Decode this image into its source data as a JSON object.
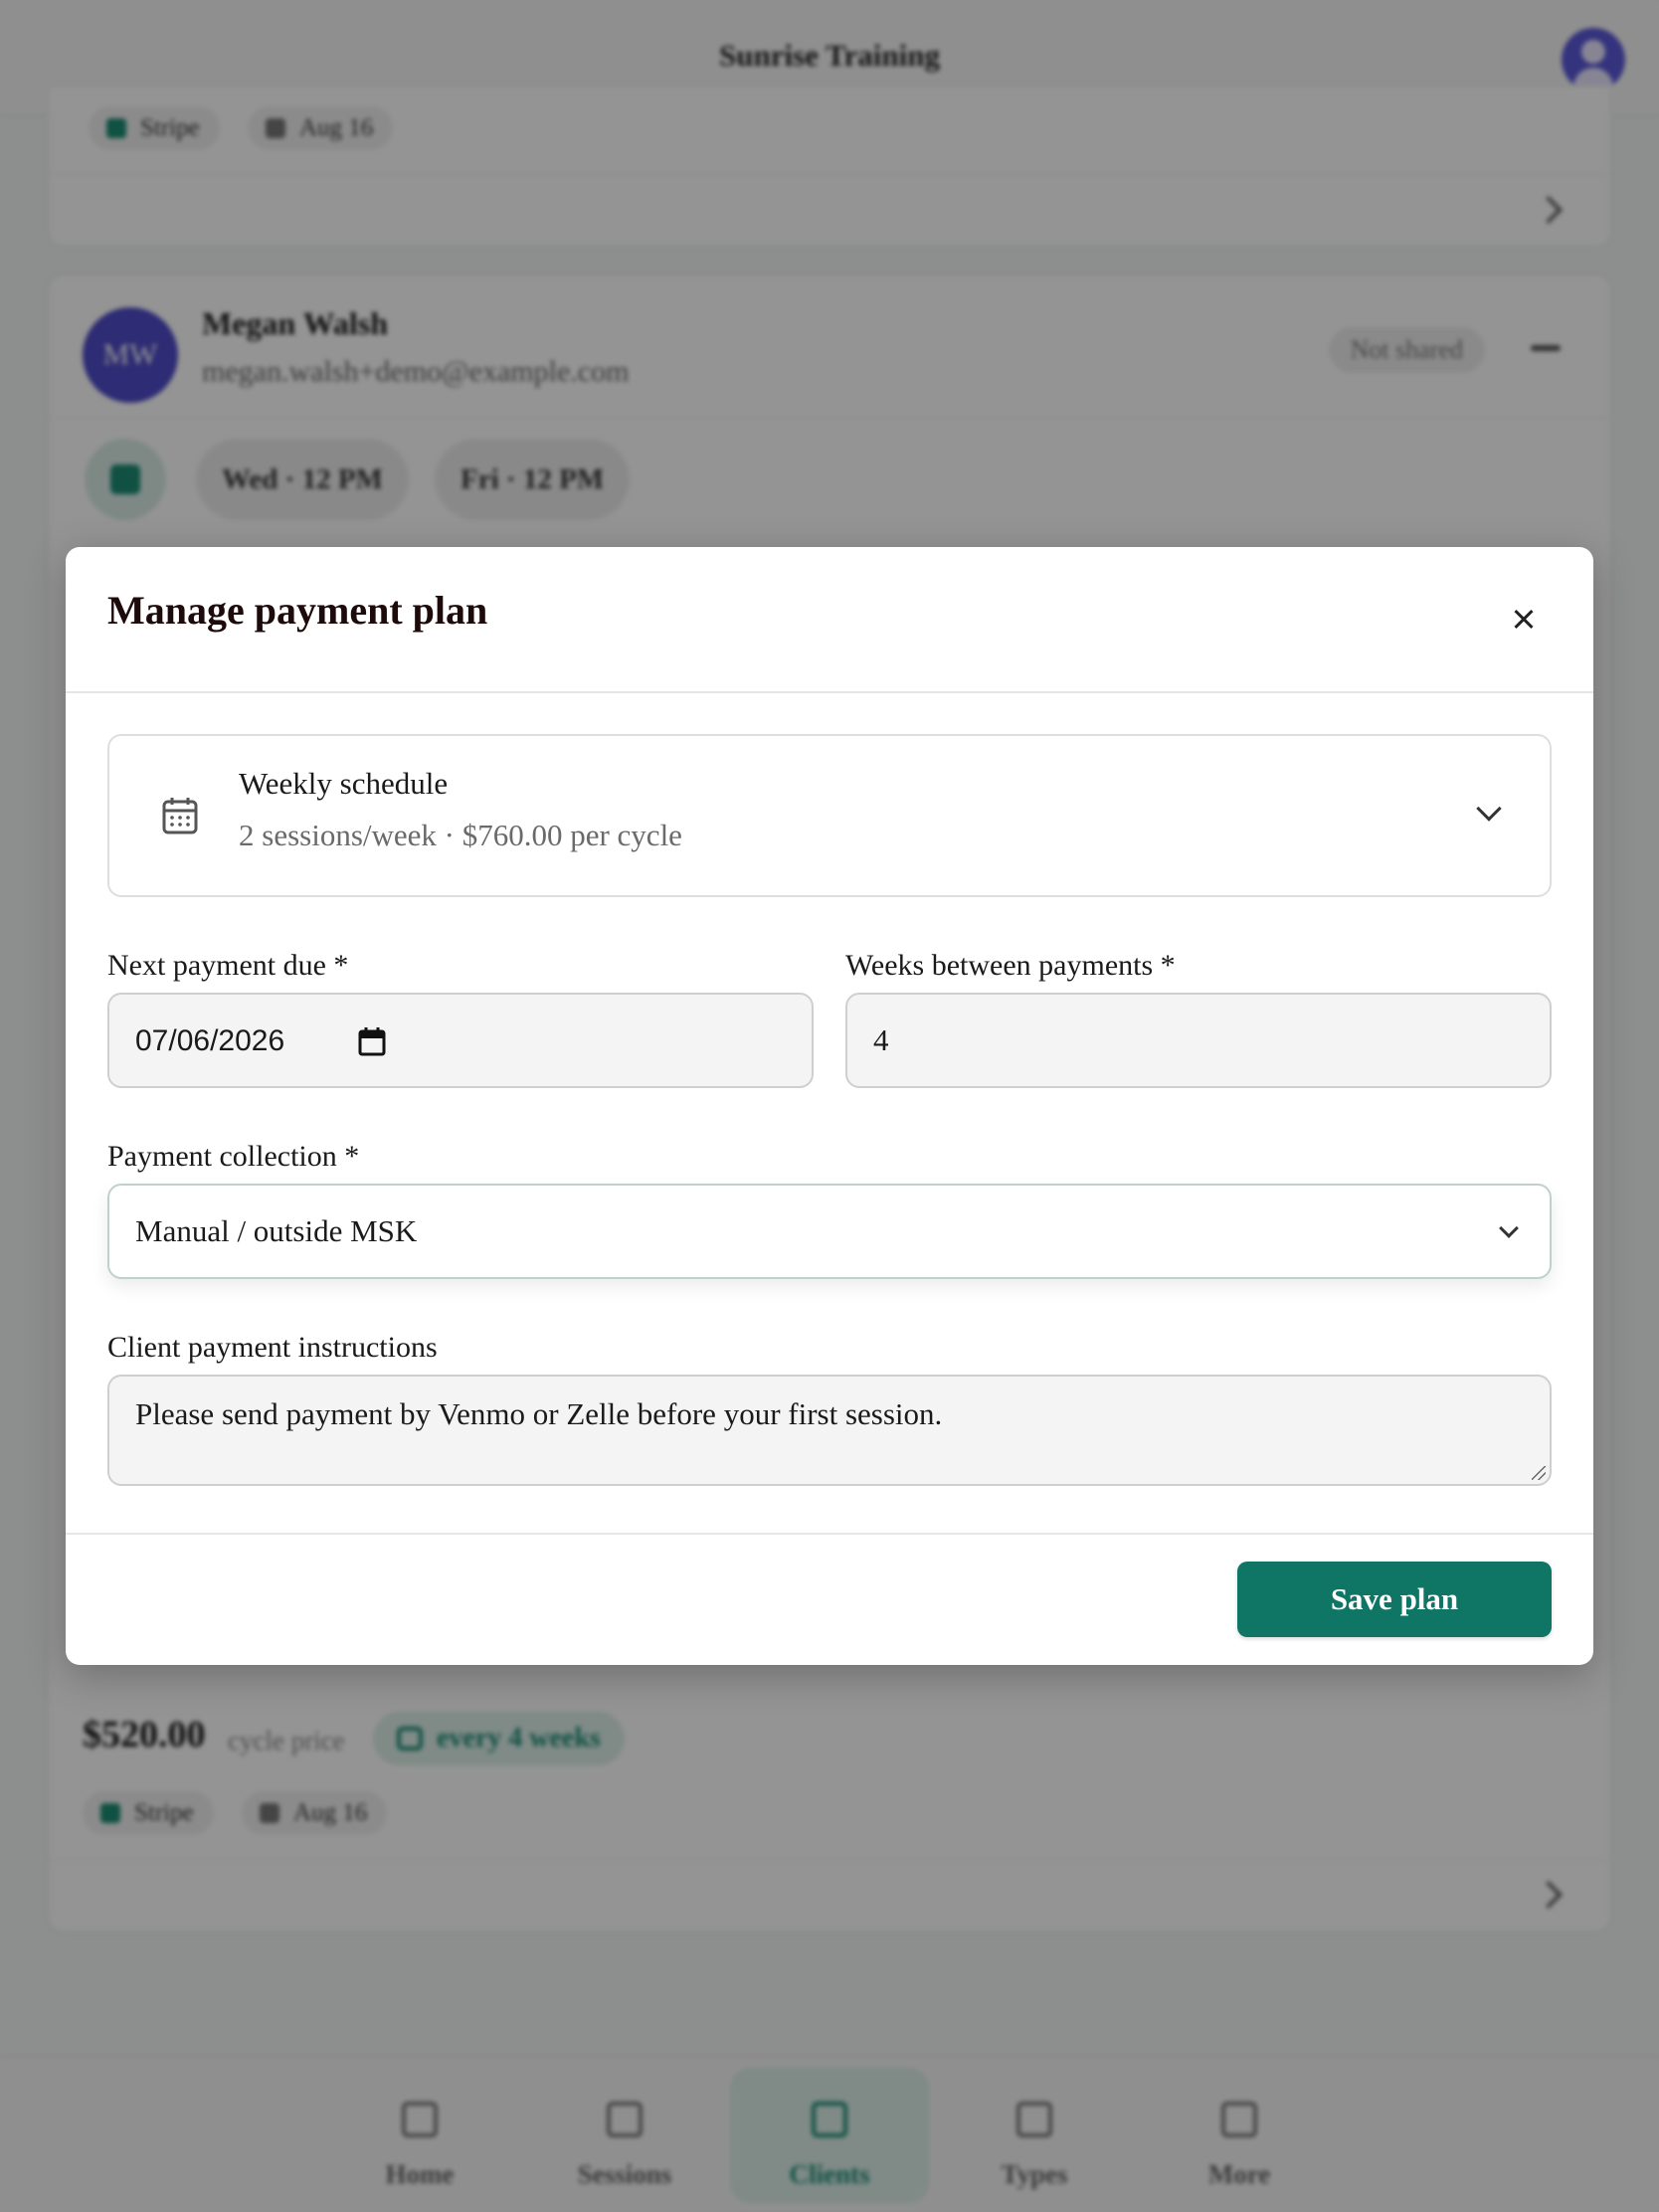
{
  "app": {
    "title": "Sunrise Training"
  },
  "background": {
    "top_card": {
      "chip_stripe": "Stripe",
      "chip_date": "Aug 16"
    },
    "client_card": {
      "avatar_initials": "MW",
      "name": "Megan Walsh",
      "email": "megan.walsh+demo@example.com",
      "share_status": "Not shared",
      "slots": [
        "Wed · 12 PM",
        "Fri · 12 PM"
      ],
      "price": "$520.00",
      "price_label": "cycle price",
      "recurrence": "every 4 weeks",
      "chip_stripe": "Stripe",
      "chip_date": "Aug 16"
    },
    "bottom_nav": [
      {
        "label": "Home",
        "icon": "home-icon"
      },
      {
        "label": "Sessions",
        "icon": "calendar-icon"
      },
      {
        "label": "Clients",
        "icon": "clients-icon",
        "active": true
      },
      {
        "label": "Types",
        "icon": "types-icon"
      },
      {
        "label": "More",
        "icon": "more-icon"
      }
    ]
  },
  "modal": {
    "title": "Manage payment plan",
    "schedule": {
      "title": "Weekly schedule",
      "subtitle": "2 sessions/week · $760.00 per cycle"
    },
    "next_payment": {
      "label": "Next payment due *",
      "value": "07/06/2026"
    },
    "weeks_between": {
      "label": "Weeks between payments *",
      "value": "4"
    },
    "collection": {
      "label": "Payment collection *",
      "value": "Manual / outside MSK"
    },
    "instructions": {
      "label": "Client payment instructions",
      "value": "Please send payment by Venmo or Zelle before your first session."
    },
    "save_label": "Save plan"
  },
  "colors": {
    "accent": "#0f7565",
    "avatar": "#4f4cc8",
    "scrim": "rgba(0,0,0,0.42)"
  }
}
